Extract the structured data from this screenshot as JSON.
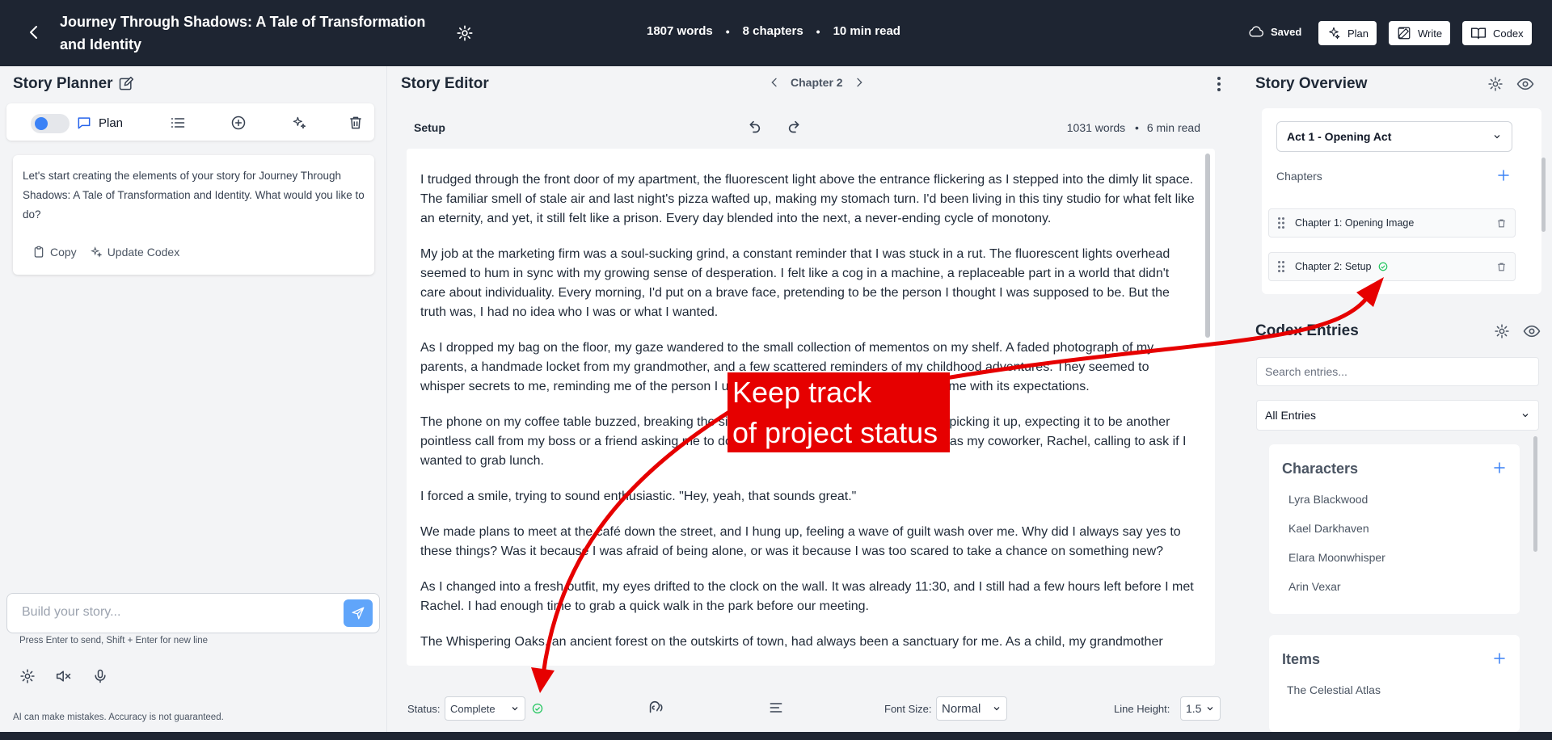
{
  "app": {
    "title": "Journey Through Shadows: A Tale of Transformation and Identity",
    "stats": {
      "words": "1807 words",
      "chapters": "8 chapters",
      "read": "10 min read"
    },
    "saved": "Saved",
    "buttons": {
      "plan": "Plan",
      "write": "Write",
      "codex": "Codex"
    }
  },
  "planner": {
    "title": "Story Planner",
    "mode_label": "Plan",
    "message": "Let's start creating the elements of your story for Journey Through Shadows: A Tale of Transformation and Identity. What would you like to do?",
    "copy": "Copy",
    "update_codex": "Update Codex",
    "input_placeholder": "Build your story...",
    "hint": "Press Enter to send, Shift + Enter for new line",
    "disclaimer": "AI can make mistakes. Accuracy is not guaranteed."
  },
  "editor": {
    "title": "Story Editor",
    "chapter": "Chapter 2",
    "section": "Setup",
    "words": "1031 words",
    "read": "6 min read",
    "paragraphs": [
      "I trudged through the front door of my apartment, the fluorescent light above the entrance flickering as I stepped into the dimly lit space. The familiar smell of stale air and last night's pizza wafted up, making my stomach turn. I'd been living in this tiny studio for what felt like an eternity, and yet, it still felt like a prison. Every day blended into the next, a never-ending cycle of monotony.",
      "My job at the marketing firm was a soul-sucking grind, a constant reminder that I was stuck in a rut. The fluorescent lights overhead seemed to hum in sync with my growing sense of desperation. I felt like a cog in a machine, a replaceable part in a world that didn't care about individuality. Every morning, I'd put on a brave face, pretending to be the person I thought I was supposed to be. But the truth was, I had no idea who I was or what I wanted.",
      "As I dropped my bag on the floor, my gaze wandered to the small collection of mementos on my shelf. A faded photograph of my parents, a handmade locket from my grandmother, and a few scattered reminders of my childhood adventures. They seemed to whisper secrets to me, reminding me of the person I used to be, before the world suffocated me with its expectations.",
      "The phone on my coffee table buzzed, breaking the silence. I hesitated for a moment before picking it up, expecting it to be another pointless call from my boss or a friend asking me to do something I didn't want to do. But it was my coworker, Rachel, calling to ask if I wanted to grab lunch.",
      "I forced a smile, trying to sound enthusiastic. \"Hey, yeah, that sounds great.\"",
      "We made plans to meet at the café down the street, and I hung up, feeling a wave of guilt wash over me. Why did I always say yes to these things? Was it because I was afraid of being alone, or was it because I was too scared to take a chance on something new?",
      "As I changed into a fresh outfit, my eyes drifted to the clock on the wall. It was already 11:30, and I still had a few hours left before I met Rachel. I had enough time to grab a quick walk in the park before our meeting.",
      "The Whispering Oaks, an ancient forest on the outskirts of town, had always been a sanctuary for me. As a child, my grandmother"
    ],
    "status_label": "Status:",
    "status_value": "Complete",
    "font_size_label": "Font Size:",
    "font_size_value": "Normal",
    "line_height_label": "Line Height:",
    "line_height_value": "1.5"
  },
  "overview": {
    "title": "Story Overview",
    "act": "Act 1 - Opening Act",
    "chapters_label": "Chapters",
    "chapters": [
      "Chapter 1: Opening Image",
      "Chapter 2: Setup"
    ]
  },
  "codex": {
    "title": "Codex Entries",
    "search_placeholder": "Search entries...",
    "filter": "All Entries",
    "characters_title": "Characters",
    "characters": [
      "Lyra Blackwood",
      "Kael Darkhaven",
      "Elara Moonwhisper",
      "Arin Vexar"
    ],
    "items_title": "Items",
    "items": [
      "The Celestial Atlas"
    ]
  },
  "annotation": {
    "line1": "Keep track",
    "line2": "of project status"
  },
  "colors": {
    "topbar": "#1e2532",
    "accent": "#3b82f6",
    "success": "#22c55e",
    "annotation": "#e60000"
  }
}
